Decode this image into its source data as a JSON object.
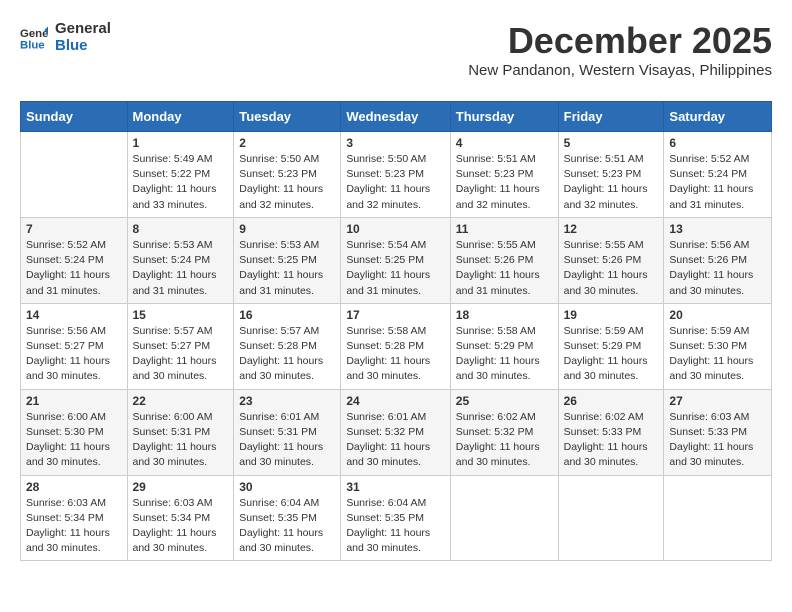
{
  "logo": {
    "line1": "General",
    "line2": "Blue"
  },
  "title": {
    "month": "December 2025",
    "location": "New Pandanon, Western Visayas, Philippines"
  },
  "weekdays": [
    "Sunday",
    "Monday",
    "Tuesday",
    "Wednesday",
    "Thursday",
    "Friday",
    "Saturday"
  ],
  "weeks": [
    [
      {
        "day": "",
        "sunrise": "",
        "sunset": "",
        "daylight": ""
      },
      {
        "day": "1",
        "sunrise": "Sunrise: 5:49 AM",
        "sunset": "Sunset: 5:22 PM",
        "daylight": "Daylight: 11 hours and 33 minutes."
      },
      {
        "day": "2",
        "sunrise": "Sunrise: 5:50 AM",
        "sunset": "Sunset: 5:23 PM",
        "daylight": "Daylight: 11 hours and 32 minutes."
      },
      {
        "day": "3",
        "sunrise": "Sunrise: 5:50 AM",
        "sunset": "Sunset: 5:23 PM",
        "daylight": "Daylight: 11 hours and 32 minutes."
      },
      {
        "day": "4",
        "sunrise": "Sunrise: 5:51 AM",
        "sunset": "Sunset: 5:23 PM",
        "daylight": "Daylight: 11 hours and 32 minutes."
      },
      {
        "day": "5",
        "sunrise": "Sunrise: 5:51 AM",
        "sunset": "Sunset: 5:23 PM",
        "daylight": "Daylight: 11 hours and 32 minutes."
      },
      {
        "day": "6",
        "sunrise": "Sunrise: 5:52 AM",
        "sunset": "Sunset: 5:24 PM",
        "daylight": "Daylight: 11 hours and 31 minutes."
      }
    ],
    [
      {
        "day": "7",
        "sunrise": "Sunrise: 5:52 AM",
        "sunset": "Sunset: 5:24 PM",
        "daylight": "Daylight: 11 hours and 31 minutes."
      },
      {
        "day": "8",
        "sunrise": "Sunrise: 5:53 AM",
        "sunset": "Sunset: 5:24 PM",
        "daylight": "Daylight: 11 hours and 31 minutes."
      },
      {
        "day": "9",
        "sunrise": "Sunrise: 5:53 AM",
        "sunset": "Sunset: 5:25 PM",
        "daylight": "Daylight: 11 hours and 31 minutes."
      },
      {
        "day": "10",
        "sunrise": "Sunrise: 5:54 AM",
        "sunset": "Sunset: 5:25 PM",
        "daylight": "Daylight: 11 hours and 31 minutes."
      },
      {
        "day": "11",
        "sunrise": "Sunrise: 5:55 AM",
        "sunset": "Sunset: 5:26 PM",
        "daylight": "Daylight: 11 hours and 31 minutes."
      },
      {
        "day": "12",
        "sunrise": "Sunrise: 5:55 AM",
        "sunset": "Sunset: 5:26 PM",
        "daylight": "Daylight: 11 hours and 30 minutes."
      },
      {
        "day": "13",
        "sunrise": "Sunrise: 5:56 AM",
        "sunset": "Sunset: 5:26 PM",
        "daylight": "Daylight: 11 hours and 30 minutes."
      }
    ],
    [
      {
        "day": "14",
        "sunrise": "Sunrise: 5:56 AM",
        "sunset": "Sunset: 5:27 PM",
        "daylight": "Daylight: 11 hours and 30 minutes."
      },
      {
        "day": "15",
        "sunrise": "Sunrise: 5:57 AM",
        "sunset": "Sunset: 5:27 PM",
        "daylight": "Daylight: 11 hours and 30 minutes."
      },
      {
        "day": "16",
        "sunrise": "Sunrise: 5:57 AM",
        "sunset": "Sunset: 5:28 PM",
        "daylight": "Daylight: 11 hours and 30 minutes."
      },
      {
        "day": "17",
        "sunrise": "Sunrise: 5:58 AM",
        "sunset": "Sunset: 5:28 PM",
        "daylight": "Daylight: 11 hours and 30 minutes."
      },
      {
        "day": "18",
        "sunrise": "Sunrise: 5:58 AM",
        "sunset": "Sunset: 5:29 PM",
        "daylight": "Daylight: 11 hours and 30 minutes."
      },
      {
        "day": "19",
        "sunrise": "Sunrise: 5:59 AM",
        "sunset": "Sunset: 5:29 PM",
        "daylight": "Daylight: 11 hours and 30 minutes."
      },
      {
        "day": "20",
        "sunrise": "Sunrise: 5:59 AM",
        "sunset": "Sunset: 5:30 PM",
        "daylight": "Daylight: 11 hours and 30 minutes."
      }
    ],
    [
      {
        "day": "21",
        "sunrise": "Sunrise: 6:00 AM",
        "sunset": "Sunset: 5:30 PM",
        "daylight": "Daylight: 11 hours and 30 minutes."
      },
      {
        "day": "22",
        "sunrise": "Sunrise: 6:00 AM",
        "sunset": "Sunset: 5:31 PM",
        "daylight": "Daylight: 11 hours and 30 minutes."
      },
      {
        "day": "23",
        "sunrise": "Sunrise: 6:01 AM",
        "sunset": "Sunset: 5:31 PM",
        "daylight": "Daylight: 11 hours and 30 minutes."
      },
      {
        "day": "24",
        "sunrise": "Sunrise: 6:01 AM",
        "sunset": "Sunset: 5:32 PM",
        "daylight": "Daylight: 11 hours and 30 minutes."
      },
      {
        "day": "25",
        "sunrise": "Sunrise: 6:02 AM",
        "sunset": "Sunset: 5:32 PM",
        "daylight": "Daylight: 11 hours and 30 minutes."
      },
      {
        "day": "26",
        "sunrise": "Sunrise: 6:02 AM",
        "sunset": "Sunset: 5:33 PM",
        "daylight": "Daylight: 11 hours and 30 minutes."
      },
      {
        "day": "27",
        "sunrise": "Sunrise: 6:03 AM",
        "sunset": "Sunset: 5:33 PM",
        "daylight": "Daylight: 11 hours and 30 minutes."
      }
    ],
    [
      {
        "day": "28",
        "sunrise": "Sunrise: 6:03 AM",
        "sunset": "Sunset: 5:34 PM",
        "daylight": "Daylight: 11 hours and 30 minutes."
      },
      {
        "day": "29",
        "sunrise": "Sunrise: 6:03 AM",
        "sunset": "Sunset: 5:34 PM",
        "daylight": "Daylight: 11 hours and 30 minutes."
      },
      {
        "day": "30",
        "sunrise": "Sunrise: 6:04 AM",
        "sunset": "Sunset: 5:35 PM",
        "daylight": "Daylight: 11 hours and 30 minutes."
      },
      {
        "day": "31",
        "sunrise": "Sunrise: 6:04 AM",
        "sunset": "Sunset: 5:35 PM",
        "daylight": "Daylight: 11 hours and 30 minutes."
      },
      {
        "day": "",
        "sunrise": "",
        "sunset": "",
        "daylight": ""
      },
      {
        "day": "",
        "sunrise": "",
        "sunset": "",
        "daylight": ""
      },
      {
        "day": "",
        "sunrise": "",
        "sunset": "",
        "daylight": ""
      }
    ]
  ]
}
